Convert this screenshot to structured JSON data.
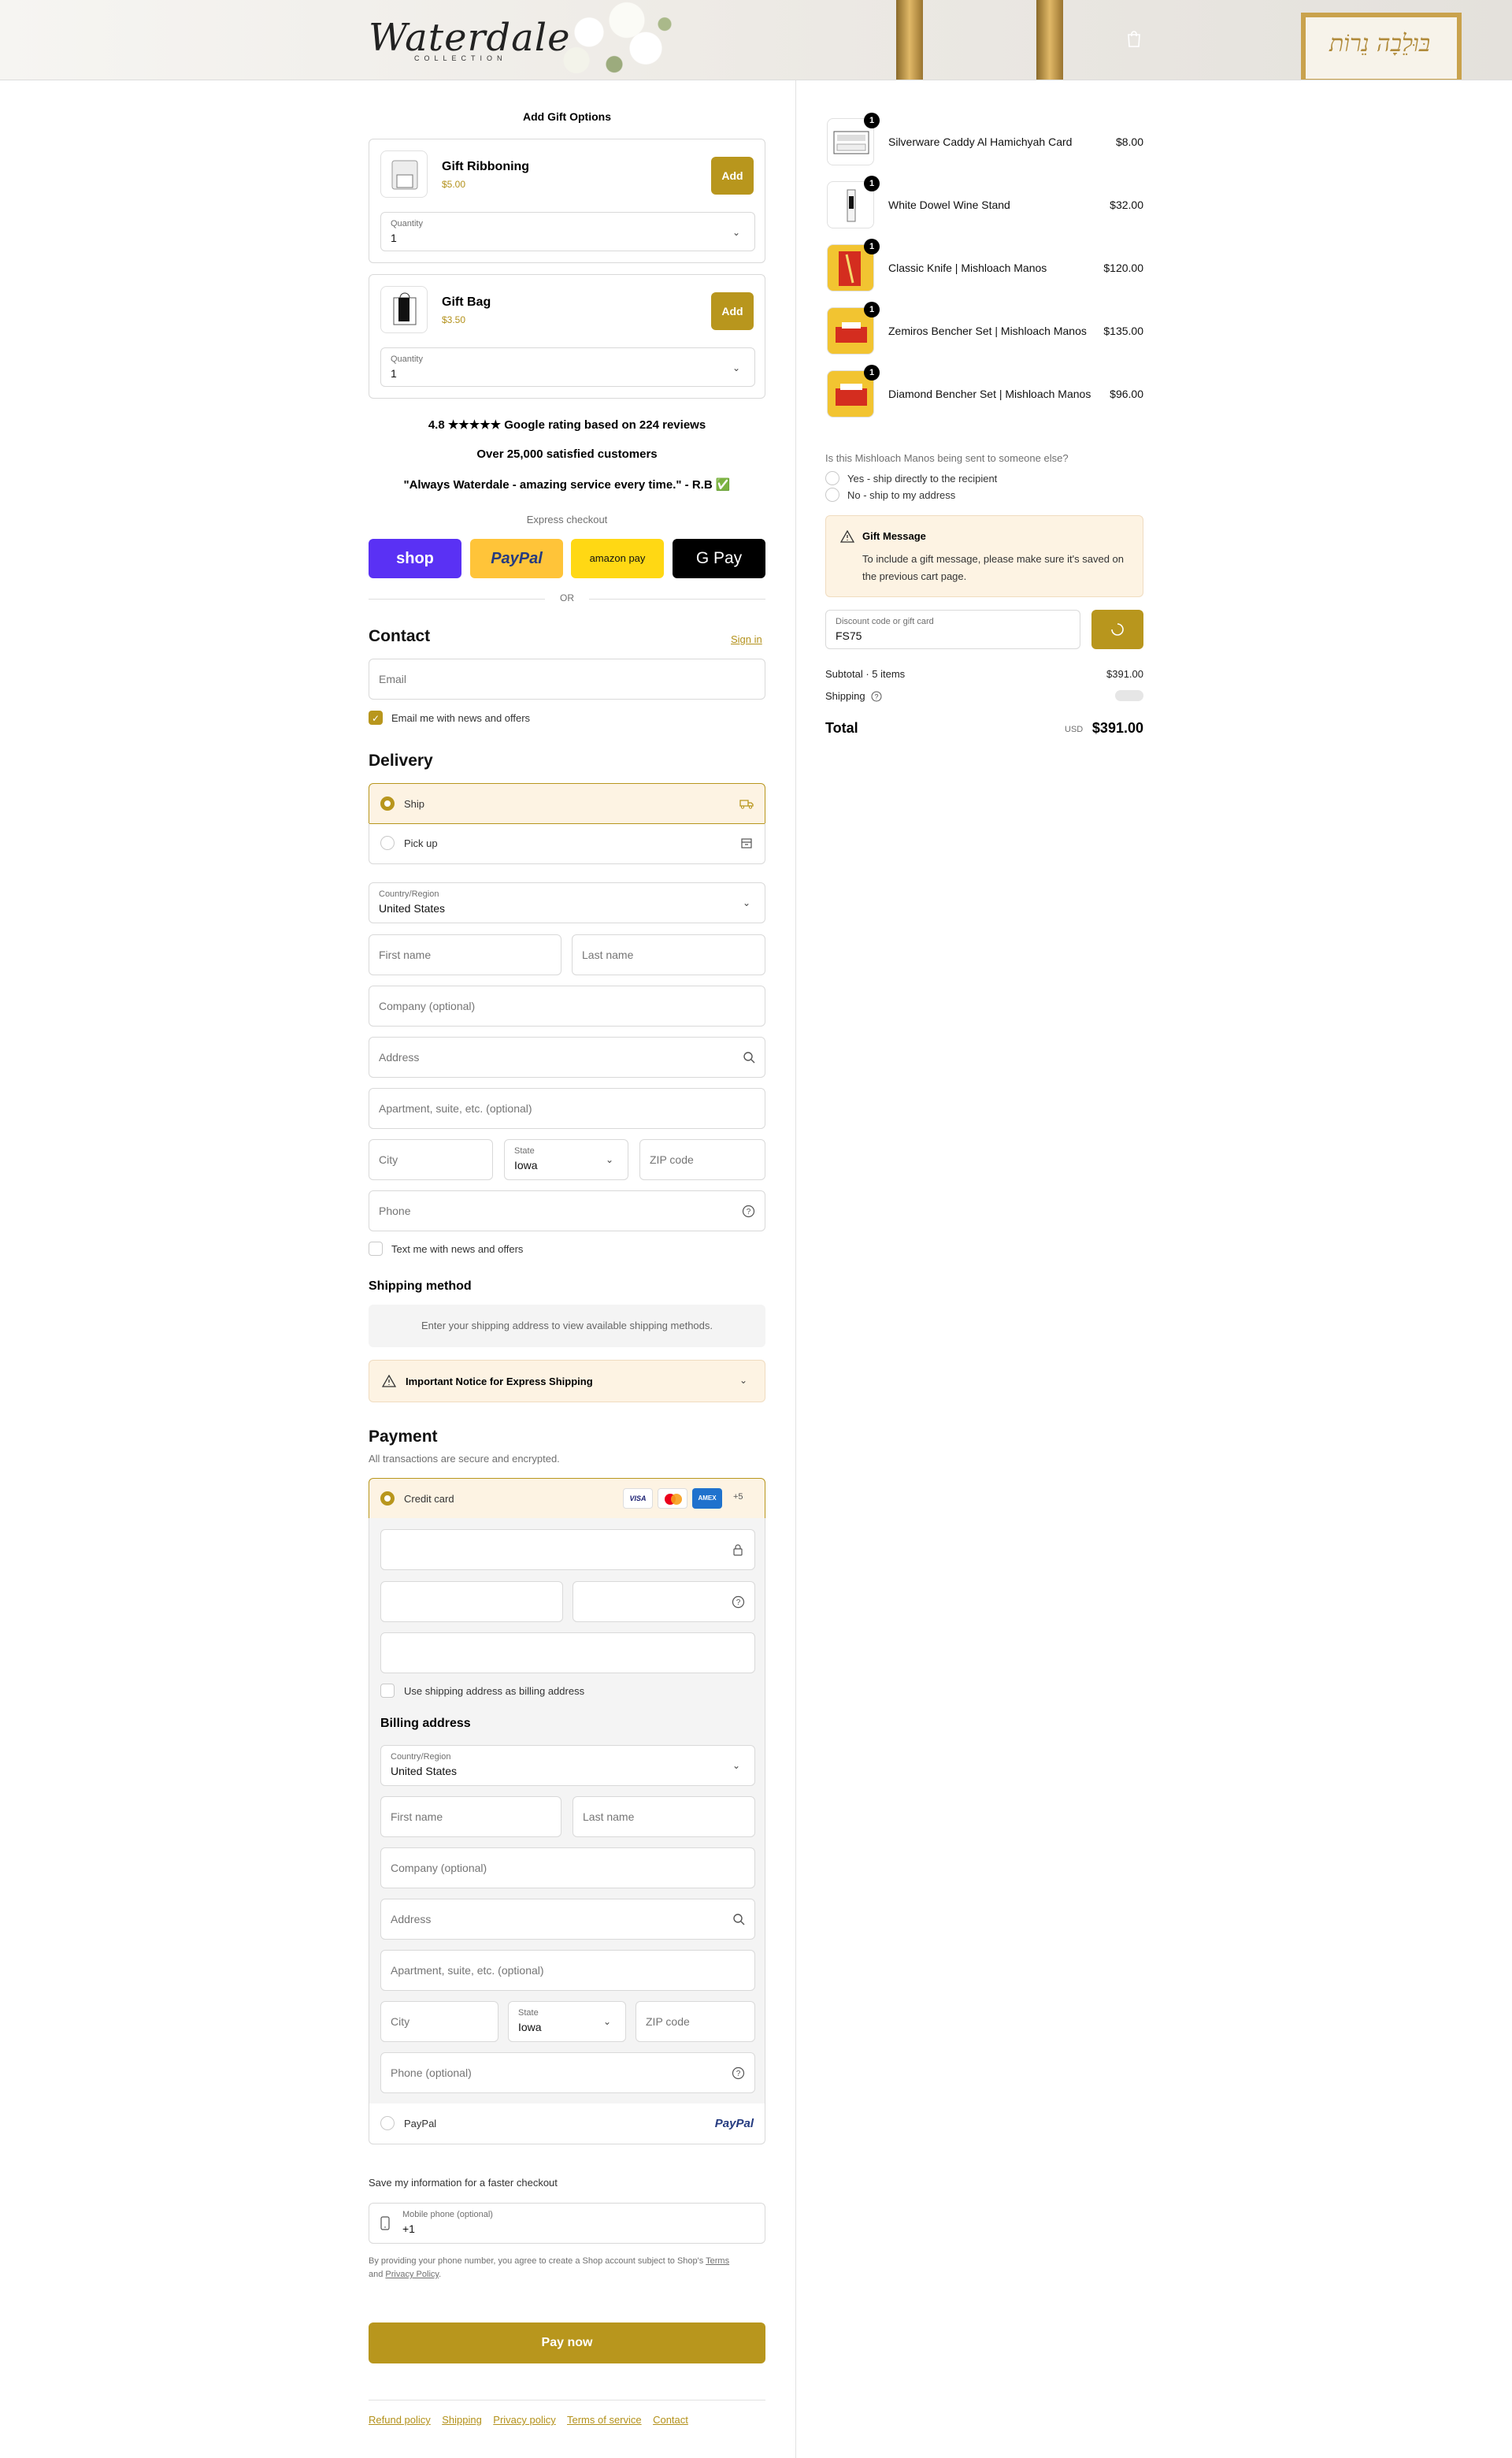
{
  "header": {
    "logo_script": "Waterdale",
    "logo_sub": "COLLECTION",
    "cart_icon": "shopping-bag-icon",
    "sign_text": "בּוּלֵבָה נֵרוֹת"
  },
  "gift_options": {
    "title": "Add Gift Options",
    "items": [
      {
        "name": "Gift Ribboning",
        "price": "$5.00",
        "button": "Add",
        "qty_label": "Quantity",
        "qty_value": "1"
      },
      {
        "name": "Gift Bag",
        "price": "$3.50",
        "button": "Add",
        "qty_label": "Quantity",
        "qty_value": "1"
      }
    ]
  },
  "trust": {
    "rating": "4.8 ★★★★★ Google rating based on 224 reviews",
    "customers": "Over 25,000 satisfied customers",
    "quote": "\"Always Waterdale - amazing service every time.\" - R.B ✅"
  },
  "express": {
    "title": "Express checkout",
    "shop": "shop",
    "paypal": "PayPal",
    "amazon": "amazon pay",
    "gpay": "G Pay",
    "or": "OR"
  },
  "contact": {
    "title": "Contact",
    "sign_in": "Sign in",
    "email_placeholder": "Email",
    "news_label": "Email me with news and offers"
  },
  "delivery": {
    "title": "Delivery",
    "ship": "Ship",
    "pickup": "Pick up",
    "country_label": "Country/Region",
    "country_value": "United States",
    "first_name": "First name",
    "last_name": "Last name",
    "company": "Company (optional)",
    "address": "Address",
    "apartment": "Apartment, suite, etc. (optional)",
    "city": "City",
    "state_label": "State",
    "state_value": "Iowa",
    "zip": "ZIP code",
    "phone": "Phone",
    "text_label": "Text me with news and offers"
  },
  "shipping_method": {
    "title": "Shipping method",
    "notice": "Enter your shipping address to view available shipping methods.",
    "important": "Important Notice for Express Shipping"
  },
  "payment": {
    "title": "Payment",
    "subtitle": "All transactions are secure and encrypted.",
    "credit_card": "Credit card",
    "cards": [
      "VISA",
      "MC",
      "AMEX"
    ],
    "more": "+5",
    "use_shipping": "Use shipping address as billing address",
    "billing_title": "Billing address",
    "country_label": "Country/Region",
    "country_value": "United States",
    "first_name": "First name",
    "last_name": "Last name",
    "company": "Company (optional)",
    "address": "Address",
    "apartment": "Apartment, suite, etc. (optional)",
    "city": "City",
    "state_label": "State",
    "state_value": "Iowa",
    "zip": "ZIP code",
    "phone": "Phone (optional)",
    "paypal": "PayPal",
    "paypal_logo": "PayPal"
  },
  "save_info": {
    "title": "Save my information for a faster checkout",
    "mobile_label": "Mobile phone (optional)",
    "mobile_value": "+1",
    "disclaimer_1": "By providing your phone number, you agree to create a Shop account subject to Shop's",
    "terms": "Terms",
    "and": "and",
    "privacy": "Privacy Policy",
    "period": "."
  },
  "pay_now": "Pay now",
  "footer_links": [
    "Refund policy",
    "Shipping",
    "Privacy policy",
    "Terms of service",
    "Contact"
  ],
  "cart": {
    "items": [
      {
        "name": "Silverware Caddy Al Hamichyah Card",
        "price": "$8.00",
        "qty": "1"
      },
      {
        "name": "White Dowel Wine Stand",
        "price": "$32.00",
        "qty": "1"
      },
      {
        "name": "Classic Knife | Mishloach Manos",
        "price": "$120.00",
        "qty": "1"
      },
      {
        "name": "Zemiros Bencher Set | Mishloach Manos",
        "price": "$135.00",
        "qty": "1"
      },
      {
        "name": "Diamond Bencher Set | Mishloach Manos",
        "price": "$96.00",
        "qty": "1"
      }
    ],
    "question": "Is this Mishloach Manos being sent to someone else?",
    "yes": "Yes - ship directly to the recipient",
    "no": "No - ship to my address",
    "gift_title": "Gift Message",
    "gift_text": "To include a gift message, please make sure it's saved on the previous cart page.",
    "discount_label": "Discount code or gift card",
    "discount_value": "FS75",
    "subtotal_label": "Subtotal · 5 items",
    "subtotal": "$391.00",
    "shipping_label": "Shipping",
    "total_label": "Total",
    "currency": "USD",
    "total": "$391.00"
  },
  "colors": {
    "accent": "#b8961d",
    "shop": "#5a31f4",
    "paypal": "#ffc439",
    "notice_bg": "#fdf3e3"
  }
}
